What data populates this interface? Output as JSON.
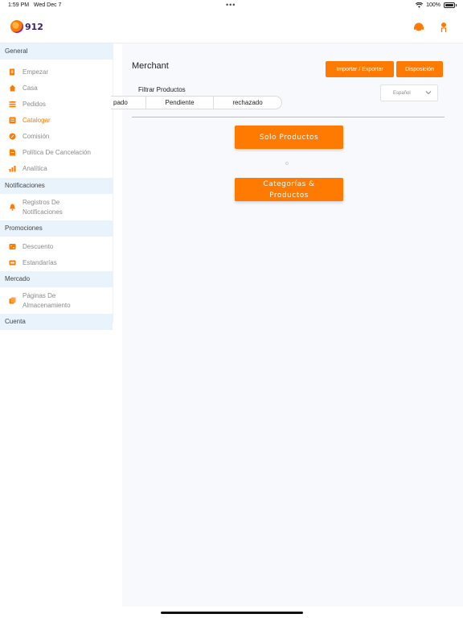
{
  "status_bar": {
    "time": "1:59 PM",
    "date": "Wed Dec 7",
    "dots": "•••",
    "battery": "100%"
  },
  "header": {
    "logo_text": "912"
  },
  "sidebar": {
    "sections": [
      {
        "title": "General",
        "items": [
          {
            "label": "Empezar",
            "icon": "document-edit-icon"
          },
          {
            "label": "Casa",
            "icon": "home-icon"
          },
          {
            "label": "Pedidos",
            "icon": "list-icon"
          },
          {
            "label": "Catalogar",
            "icon": "catalog-icon",
            "active": true
          },
          {
            "label": "Comisión",
            "icon": "percent-icon"
          },
          {
            "label": "Política De Cancelación",
            "icon": "policy-icon"
          },
          {
            "label": "Analítica",
            "icon": "chart-icon"
          }
        ]
      },
      {
        "title": "Notificaciones",
        "items": [
          {
            "label": "Registros De Notificaciones",
            "icon": "bell-icon"
          }
        ]
      },
      {
        "title": "Promociones",
        "items": [
          {
            "label": "Descuento",
            "icon": "discount-icon"
          },
          {
            "label": "Estandarías",
            "icon": "banner-icon"
          }
        ]
      },
      {
        "title": "Mercado",
        "items": [
          {
            "label": "Páginas De Almacenamiento",
            "icon": "pages-icon"
          }
        ]
      },
      {
        "title": "Cuenta",
        "items": []
      }
    ]
  },
  "main": {
    "title": "Merchant",
    "import_export": "Importar / Exportar",
    "layout_button": "Disposición",
    "language": "Español",
    "filter_label": "Filtrar Productos",
    "filter_tabs": [
      "pado",
      "Pendiente",
      "rechazado"
    ],
    "only_products": "Solo Productos",
    "or": "o",
    "categories_products": "Categorías & Productos"
  },
  "colors": {
    "accent": "#ff7a00",
    "section_bg": "#e8f3fc",
    "main_bg": "#f8f9fc"
  }
}
